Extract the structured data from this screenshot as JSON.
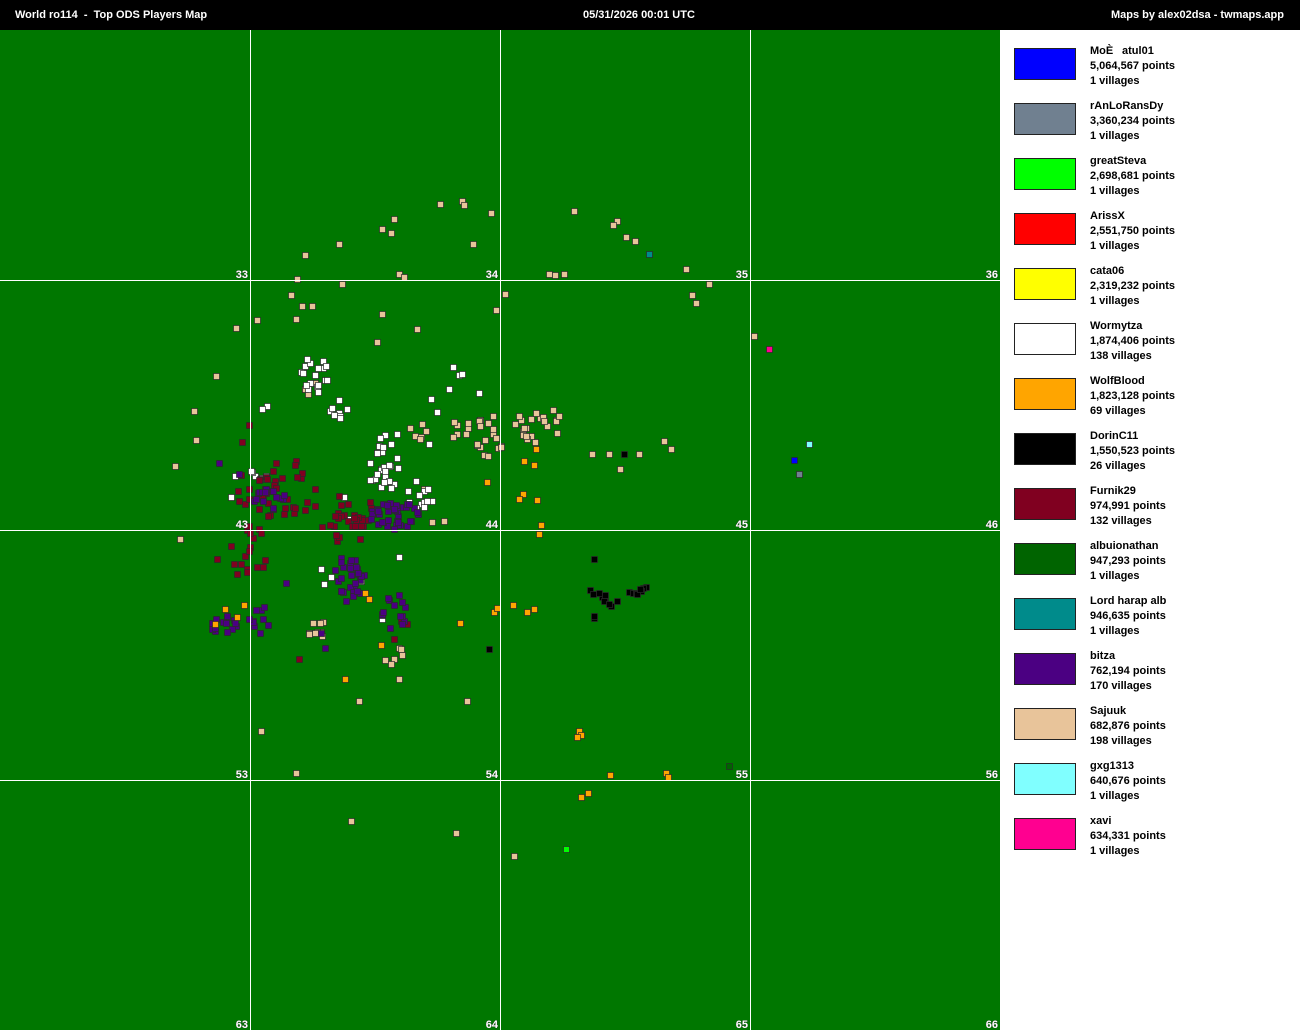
{
  "header": {
    "title": "World ro114  -  Top ODS Players Map",
    "date": "05/31/2026 00:01 UTC",
    "credit": "Maps by alex02dsa - twmaps.app"
  },
  "map": {
    "background": "#007700",
    "grid_color": "#ffffff",
    "grid_labels": [
      "33",
      "34",
      "35",
      "36",
      "43",
      "44",
      "45",
      "46",
      "53",
      "54",
      "55",
      "56",
      "63",
      "64",
      "65",
      "66"
    ]
  },
  "legend": [
    {
      "name": "MoÈatul01",
      "points": "5,064,567 points",
      "villages": "1 villages",
      "color": "#0000ff"
    },
    {
      "name": "rAnLoRansDy",
      "points": "3,360,234 points",
      "villages": "1 villages",
      "color": "#708090"
    },
    {
      "name": "greatSteva",
      "points": "2,698,681 points",
      "villages": "1 villages",
      "color": "#00ff00"
    },
    {
      "name": "ArissX",
      "points": "2,551,750 points",
      "villages": "1 villages",
      "color": "#ff0000"
    },
    {
      "name": "cata06",
      "points": "2,319,232 points",
      "villages": "1 villages",
      "color": "#ffff00"
    },
    {
      "name": "Wormytza",
      "points": "1,874,406 points",
      "villages": "138 villages",
      "color": "#ffffff"
    },
    {
      "name": "WolfBlood",
      "points": "1,823,128 points",
      "villages": "69 villages",
      "color": "#ffa500"
    },
    {
      "name": "DorinC11",
      "points": "1,550,523 points",
      "villages": "26 villages",
      "color": "#000000"
    },
    {
      "name": "Furnik29",
      "points": "974,991 points",
      "villages": "132 villages",
      "color": "#800020"
    },
    {
      "name": "albuionathan",
      "points": "947,293 points",
      "villages": "1 villages",
      "color": "#006400"
    },
    {
      "name": "Lord harap alb",
      "points": "946,635 points",
      "villages": "1 villages",
      "color": "#008b8b"
    },
    {
      "name": "bitza",
      "points": "762,194 points",
      "villages": "170 villages",
      "color": "#4b0082"
    },
    {
      "name": "Sajuuk",
      "points": "682,876 points",
      "villages": "198 villages",
      "color": "#e8c49a"
    },
    {
      "name": "gxg1313",
      "points": "640,676 points",
      "villages": "1 villages",
      "color": "#80ffff"
    },
    {
      "name": "xavi",
      "points": "634,331 points",
      "villages": "1 villages",
      "color": "#ff0090"
    }
  ]
}
